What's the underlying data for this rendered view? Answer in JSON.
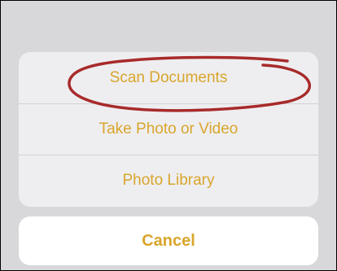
{
  "action_sheet": {
    "items": [
      {
        "label": "Scan Documents"
      },
      {
        "label": "Take Photo or Video"
      },
      {
        "label": "Photo Library"
      }
    ],
    "cancel_label": "Cancel"
  },
  "colors": {
    "accent": "#d9a52c",
    "annotation": "#a82a2a",
    "backdrop": "#d8d8da",
    "sheet": "#eeeef0"
  }
}
